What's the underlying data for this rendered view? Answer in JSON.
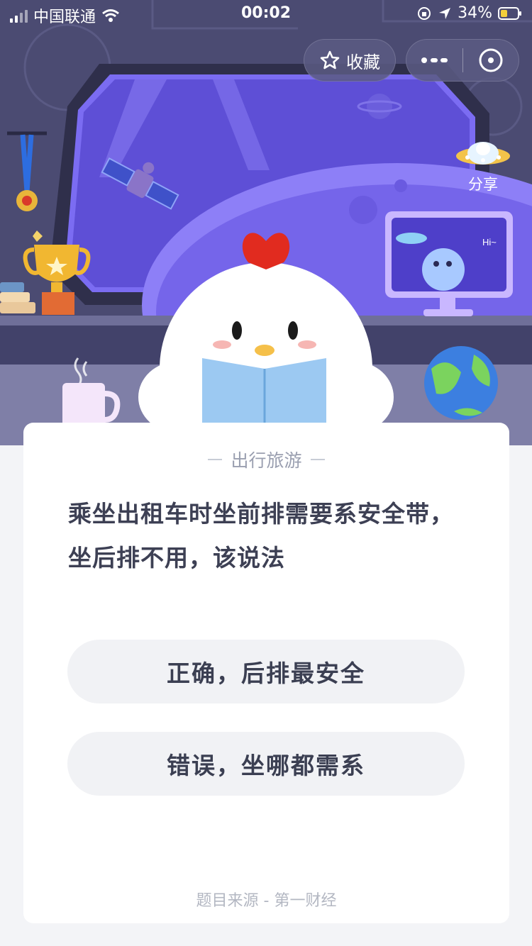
{
  "status_bar": {
    "carrier": "中国联通",
    "time": "00:02",
    "battery": "34%"
  },
  "header": {
    "favorite_label": "收藏",
    "more_label": "···",
    "share_label": "分享"
  },
  "scene": {
    "monitor_text": "Hi~"
  },
  "card": {
    "category": "出行旅游",
    "question": "乘坐出租车时坐前排需要系安全带，坐后排不用，该说法",
    "options": [
      {
        "label": "正确，后排最安全"
      },
      {
        "label": "错误，坐哪都需系"
      }
    ],
    "source": "题目来源 - 第一财经"
  },
  "colors": {
    "scene_bg": "#4b4b72",
    "window_glass": "#5e4fd6",
    "card_bg": "#ffffff",
    "option_bg": "#f1f2f5",
    "text_dark": "#3d4054",
    "text_muted": "#9a9fb0"
  },
  "icons": {
    "signal": "signal-icon",
    "wifi": "wifi-icon",
    "orientation_lock": "orientation-lock-icon",
    "location": "location-arrow-icon",
    "battery": "battery-icon",
    "favorite": "star-outline-icon",
    "close": "close-target-icon",
    "share": "ufo-share-icon"
  }
}
